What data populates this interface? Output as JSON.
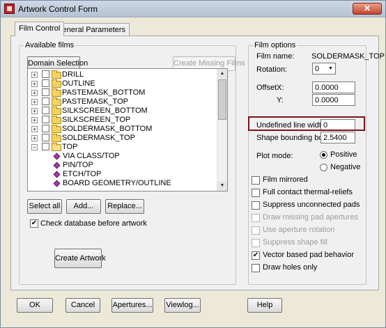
{
  "window": {
    "title": "Artwork Control Form",
    "close_glyph": "✕"
  },
  "tabs": [
    {
      "label": "Film Control"
    },
    {
      "label": "General Parameters"
    }
  ],
  "available_films": {
    "legend": "Available films",
    "domain_selection_label": "Domain Selection",
    "create_missing_films_label": "Create Missing Films",
    "tree": [
      {
        "label": "DRILL",
        "icon": "folder-icon",
        "expander": "+"
      },
      {
        "label": "OUTLINE",
        "icon": "folder-icon",
        "expander": "+"
      },
      {
        "label": "PASTEMASK_BOTTOM",
        "icon": "folder-icon",
        "expander": "+"
      },
      {
        "label": "PASTEMASK_TOP",
        "icon": "folder-icon",
        "expander": "+"
      },
      {
        "label": "SILKSCREEN_BOTTOM",
        "icon": "folder-icon",
        "expander": "+"
      },
      {
        "label": "SILKSCREEN_TOP",
        "icon": "folder-icon",
        "expander": "+"
      },
      {
        "label": "SOLDERMASK_BOTTOM",
        "icon": "folder-icon",
        "expander": "+"
      },
      {
        "label": "SOLDERMASK_TOP",
        "icon": "folder-icon",
        "expander": "+"
      },
      {
        "label": "TOP",
        "icon": "open-folder-icon",
        "expander": "−"
      },
      {
        "label": "VIA CLASS/TOP",
        "icon": "layer-diamond-icon"
      },
      {
        "label": "PIN/TOP",
        "icon": "layer-diamond-icon"
      },
      {
        "label": "ETCH/TOP",
        "icon": "layer-diamond-icon"
      },
      {
        "label": "BOARD GEOMETRY/OUTLINE",
        "icon": "layer-diamond-icon"
      }
    ],
    "select_all_label": "Select all",
    "add_label": "Add...",
    "replace_label": "Replace...",
    "check_database_label": "Check database before artwork",
    "check_database_checked": true,
    "create_artwork_label": "Create Artwork"
  },
  "film_options": {
    "legend": "Film options",
    "film_name_label": "Film name:",
    "film_name_value": "SOLDERMASK_TOP",
    "rotation_label": "Rotation:",
    "rotation_value": "0",
    "offset_label": "Offset",
    "offset_x_label": "X:",
    "offset_x_value": "0.0000",
    "offset_y_label": "Y:",
    "offset_y_value": "0.0000",
    "undefined_line_width_label": "Undefined line width:",
    "undefined_line_width_value": "0",
    "shape_bounding_box_label": "Shape bounding box:",
    "shape_bounding_box_value": "2.5400",
    "plot_mode_label": "Plot mode:",
    "plot_mode_positive": "Positive",
    "plot_mode_negative": "Negative",
    "options": [
      {
        "label": "Film mirrored",
        "checked": false,
        "enabled": true
      },
      {
        "label": "Full contact thermal-reliefs",
        "checked": false,
        "enabled": true
      },
      {
        "label": "Suppress unconnected pads",
        "checked": false,
        "enabled": true
      },
      {
        "label": "Draw missing pad apertures",
        "checked": false,
        "enabled": false
      },
      {
        "label": "Use aperture rotation",
        "checked": false,
        "enabled": false
      },
      {
        "label": "Suppress shape fill",
        "checked": false,
        "enabled": false
      },
      {
        "label": "Vector based pad behavior",
        "checked": true,
        "enabled": true
      },
      {
        "label": "Draw holes only",
        "checked": false,
        "enabled": true
      }
    ]
  },
  "footer": {
    "ok_label": "OK",
    "cancel_label": "Cancel",
    "apertures_label": "Apertures...",
    "viewlog_label": "Viewlog...",
    "help_label": "Help"
  },
  "colors": {
    "highlight_border": "#7a1418",
    "folder": "#f3d363",
    "layer_icon": "#a23ca8"
  }
}
